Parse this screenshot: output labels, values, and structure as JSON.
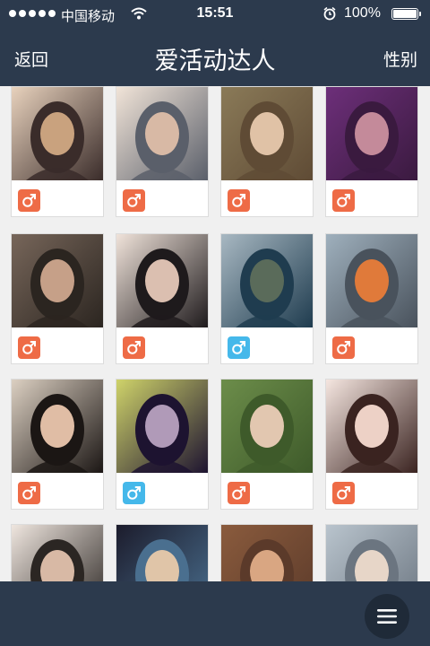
{
  "status_bar": {
    "carrier": "中国移动",
    "time": "15:51",
    "battery": "100%",
    "icons": [
      "signal-dots-icon",
      "wifi-icon",
      "alarm-icon",
      "battery-icon"
    ]
  },
  "navbar": {
    "back_label": "返回",
    "title": "爱活动达人",
    "gender_filter_label": "性别"
  },
  "colors": {
    "bar": "#2c3a4d",
    "male_badge_orange": "#ee6b46",
    "male_badge_blue": "#45b8ea",
    "background": "#f0f0f0"
  },
  "users": [
    {
      "photo": "portrait-photo",
      "badge_color": "orange",
      "badge_icon": "male-symbol-icon"
    },
    {
      "photo": "portrait-photo",
      "badge_color": "orange",
      "badge_icon": "male-symbol-icon"
    },
    {
      "photo": "portrait-photo",
      "badge_color": "orange",
      "badge_icon": "male-symbol-icon"
    },
    {
      "photo": "portrait-photo",
      "badge_color": "orange",
      "badge_icon": "male-symbol-icon"
    },
    {
      "photo": "portrait-photo",
      "badge_color": "orange",
      "badge_icon": "male-symbol-icon"
    },
    {
      "photo": "portrait-photo",
      "badge_color": "orange",
      "badge_icon": "male-symbol-icon"
    },
    {
      "photo": "outdoor-photo",
      "badge_color": "blue",
      "badge_icon": "male-symbol-icon"
    },
    {
      "photo": "outdoor-photo",
      "badge_color": "orange",
      "badge_icon": "male-symbol-icon"
    },
    {
      "photo": "portrait-photo",
      "badge_color": "orange",
      "badge_icon": "male-symbol-icon"
    },
    {
      "photo": "masked-portrait-photo",
      "badge_color": "blue",
      "badge_icon": "male-symbol-icon"
    },
    {
      "photo": "outdoor-photo",
      "badge_color": "orange",
      "badge_icon": "male-symbol-icon"
    },
    {
      "photo": "portrait-photo",
      "badge_color": "orange",
      "badge_icon": "male-symbol-icon"
    },
    {
      "photo": "portrait-photo",
      "badge_color": null,
      "badge_icon": null
    },
    {
      "photo": "portrait-photo",
      "badge_color": null,
      "badge_icon": null
    },
    {
      "photo": "portrait-photo",
      "badge_color": null,
      "badge_icon": null
    },
    {
      "photo": "outdoor-photo",
      "badge_color": null,
      "badge_icon": null
    }
  ],
  "bottom_bar": {
    "menu_icon": "hamburger-menu-icon"
  }
}
